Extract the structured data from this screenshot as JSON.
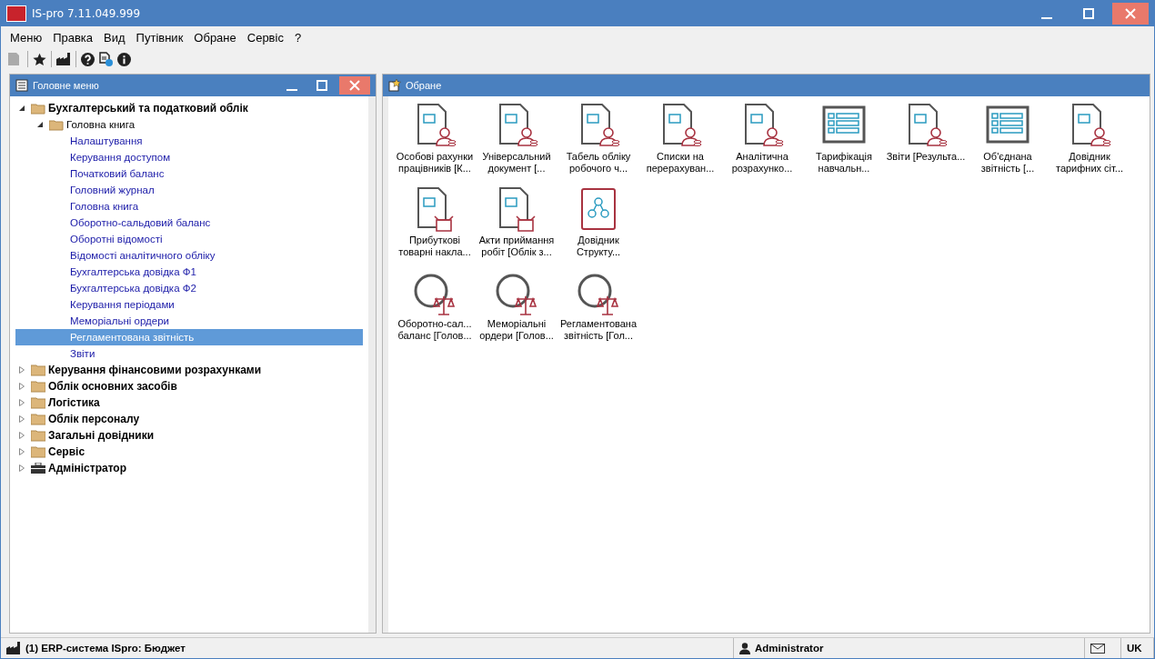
{
  "window": {
    "title": "IS-pro 7.11.049.999"
  },
  "menu": [
    "Меню",
    "Правка",
    "Вид",
    "Путівник",
    "Обране",
    "Сервіс",
    "?"
  ],
  "toolbar": [
    {
      "kind": "folder",
      "disabled": true
    },
    {
      "kind": "separator"
    },
    {
      "kind": "star",
      "disabled": false
    },
    {
      "kind": "separator"
    },
    {
      "kind": "factory",
      "disabled": false
    },
    {
      "kind": "separator"
    },
    {
      "kind": "help",
      "disabled": false
    },
    {
      "kind": "doc-help",
      "disabled": false
    },
    {
      "kind": "info",
      "disabled": false
    }
  ],
  "left_panel": {
    "title": "Головне меню",
    "tree": [
      {
        "label": "Бухгалтерський та податковий облік",
        "kind": "folder",
        "expanded": true,
        "selected": false,
        "children": [
          {
            "label": "Головна книга",
            "kind": "folder",
            "expanded": true,
            "selected": false,
            "children": [
              {
                "label": "Налаштування",
                "selected": false
              },
              {
                "label": "Керування доступом",
                "selected": false
              },
              {
                "label": "Початковий баланс",
                "selected": false
              },
              {
                "label": "Головний журнал",
                "selected": false
              },
              {
                "label": "Головна книга",
                "selected": false
              },
              {
                "label": "Оборотно-сальдовий баланс",
                "selected": false
              },
              {
                "label": "Оборотні відомості",
                "selected": false
              },
              {
                "label": "Відомості аналітичного обліку",
                "selected": false
              },
              {
                "label": "Бухгалтерська довідка Ф1",
                "selected": false
              },
              {
                "label": "Бухгалтерська довідка Ф2",
                "selected": false
              },
              {
                "label": "Керування періодами",
                "selected": false
              },
              {
                "label": "Меморіальні ордери",
                "selected": false
              },
              {
                "label": "Регламентована звітність",
                "selected": true
              },
              {
                "label": "Звіти",
                "selected": false
              }
            ]
          }
        ]
      },
      {
        "label": "Керування фінансовими розрахунками",
        "kind": "folder",
        "expanded": false,
        "selected": false
      },
      {
        "label": "Облік основних засобів",
        "kind": "folder",
        "expanded": false,
        "selected": false
      },
      {
        "label": "Логістика",
        "kind": "folder",
        "expanded": false,
        "selected": false
      },
      {
        "label": "Облік персоналу",
        "kind": "folder",
        "expanded": false,
        "selected": false
      },
      {
        "label": "Загальні довідники",
        "kind": "folder",
        "expanded": false,
        "selected": false
      },
      {
        "label": "Сервіс",
        "kind": "folder",
        "expanded": false,
        "selected": false
      },
      {
        "label": "Адміністратор",
        "kind": "toolbox",
        "expanded": false,
        "selected": false
      }
    ]
  },
  "right_panel": {
    "title": "Обране",
    "rows": [
      [
        {
          "label": "Особові рахунки працівників [К...",
          "kind": "person"
        },
        {
          "label": "Універсальний документ [...",
          "kind": "person"
        },
        {
          "label": "Табель обліку робочого ч...",
          "kind": "person"
        },
        {
          "label": "Списки на перерахуван...",
          "kind": "person"
        },
        {
          "label": "Аналітична розрахунко...",
          "kind": "person"
        },
        {
          "label": "Тарифікація навчальн...",
          "kind": "table"
        },
        {
          "label": "Звіти [Результа...",
          "kind": "person"
        },
        {
          "label": "Об'єднана звітність [...",
          "kind": "table"
        },
        {
          "label": "Довідник тарифних сіт...",
          "kind": "person"
        }
      ],
      [
        {
          "label": "Прибуткові товарні накла...",
          "kind": "box"
        },
        {
          "label": "Акти приймання робіт [Облік з...",
          "kind": "box"
        },
        {
          "label": "Довідник Структу...",
          "kind": "book"
        }
      ],
      [
        {
          "label": "Оборотно-сал... баланс [Голов...",
          "kind": "scales"
        },
        {
          "label": "Меморіальні ордери [Голов...",
          "kind": "scales"
        },
        {
          "label": "Регламентована звітність [Гол...",
          "kind": "scales"
        }
      ]
    ]
  },
  "status_bar": {
    "system": "(1) ERP-система ISpro: Бюджет",
    "user": "Administrator",
    "language": "UK"
  }
}
